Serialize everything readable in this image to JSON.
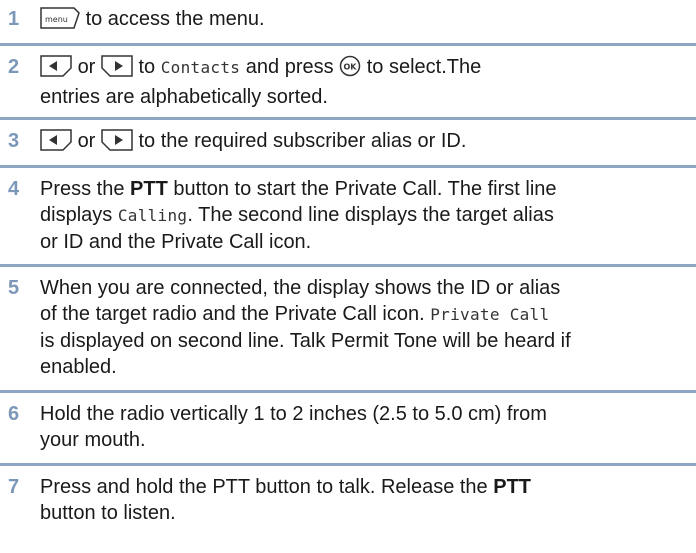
{
  "steps": [
    {
      "number": "1",
      "icon": "menu-key-icon",
      "icon_label": "menu",
      "text": "to access the menu."
    },
    {
      "number": "2",
      "or": "or",
      "to": "to",
      "mono": "Contacts",
      "and_press": "and press",
      "ok_label": "OK",
      "select": "to select.The",
      "line2": "entries are alphabetically sorted."
    },
    {
      "number": "3",
      "or": "or",
      "text": "to the required subscriber alias or ID."
    },
    {
      "number": "4",
      "pre": "Press the",
      "bold": "PTT",
      "post": "button to start the Private Call. The first line",
      "l2a": "displays",
      "l2mono": "Calling",
      "l2b": ". The second line displays the target alias",
      "l3": "or ID and the Private Call icon."
    },
    {
      "number": "5",
      "l1": "When you are connected, the display shows the ID or alias",
      "l2a": "of the target radio and the Private Call icon.",
      "l2mono": "Private Call",
      "l3": "is displayed on second line. Talk Permit Tone will be heard if",
      "l4": "enabled."
    },
    {
      "number": "6",
      "l1": "Hold the radio vertically 1 to 2 inches (2.5 to 5.0 cm) from",
      "l2": "your mouth."
    },
    {
      "number": "7",
      "l1a": "Press and hold the PTT button to talk. Release the",
      "l1bold": "PTT",
      "l2": "button to listen."
    }
  ]
}
